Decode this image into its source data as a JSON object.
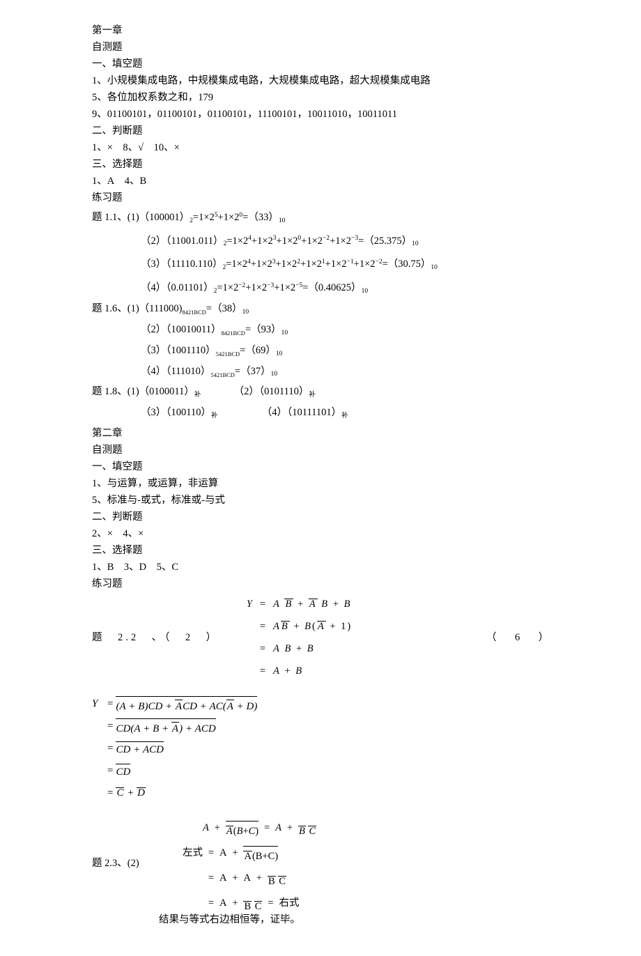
{
  "ch1": {
    "title": "第一章",
    "self": "自测题",
    "s1": "一、填空题",
    "q1": "1、小规模集成电路，中规模集成电路，大规模集成电路，超大规模集成电路",
    "q5": "5、各位加权系数之和，179",
    "q9": "9、01100101，01100101，01100101，11100101，10011010，10011011",
    "s2": "二、判断题",
    "j": "1、× 8、√ 10、×",
    "s3": "三、选择题",
    "c": "1、A 4、B",
    "ex": "练习题",
    "p11_a": "题 1.1、(1)（100001）",
    "p11_a2": "=1×2",
    "p11_a3": "+1×2",
    "p11_a4": "=（33）",
    "p11_b": "（2）（11001.011）",
    "p11_b_tail": "=（25.375）",
    "p11_c": "（3）（11110.110）",
    "p11_c_tail": "=（30.75）",
    "p11_d": "（4）（0.01101）",
    "p11_d_tail": "=（0.40625）",
    "p16_a": "题 1.6、(1)（111000)",
    "p16_a2": "=（38）",
    "p16_b": "（2）（10010011）",
    "p16_b2": "=（93）",
    "p16_c": "（3）（1001110）",
    "p16_c2": "=（69）",
    "p16_d": "（4）（111010）",
    "p16_d2": "=（37）",
    "p18_a": "题 1.8、(1)（0100011）",
    "p18_b": "（2）（0101110）",
    "p18_c": "（3）（100110）",
    "p18_d": "（4）（10111101）",
    "bu": "补"
  },
  "ch2": {
    "title": "第二章",
    "self": "自测题",
    "s1": "一、填空题",
    "q1": "1、与运算，或运算，非运算",
    "q5": "5、标准与-或式，标准或-与式",
    "s2": "二、判断题",
    "j": "2、× 4、×",
    "s3": "三、选择题",
    "c": "1、B 3、D 5、C",
    "ex": "练习题",
    "p22_left": "题 2.2 、（ 2 ）",
    "p22_right": "（ 6 ）",
    "p23_left": "题 2.3、(2)",
    "p23_zuo": "左式",
    "p23_you": "右式",
    "conclude": "结果与等式右边相恒等，证毕。"
  },
  "sub": {
    "s2": "2",
    "s10": "10",
    "bcd84": "8421BCD",
    "bcd54": "5421BCD"
  },
  "sup": {
    "p5": "5",
    "p0": "0",
    "p4": "4",
    "p3": "3",
    "p2": "2",
    "p1": "1",
    "m1": "−1",
    "m2": "−2",
    "m3": "−3",
    "m5": "−5"
  }
}
